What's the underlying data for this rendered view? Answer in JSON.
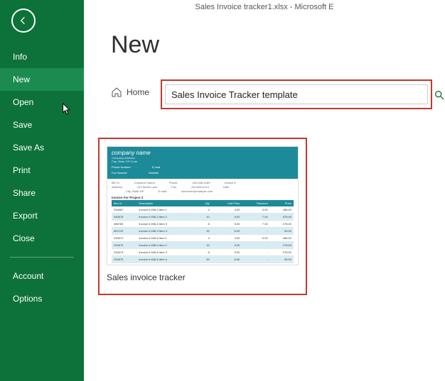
{
  "titlebar": "Sales Invoice tracker1.xlsx - Microsoft E",
  "page_title": "New",
  "sidebar": {
    "items": [
      {
        "label": "Info"
      },
      {
        "label": "New"
      },
      {
        "label": "Open"
      },
      {
        "label": "Save"
      },
      {
        "label": "Save As"
      },
      {
        "label": "Print"
      },
      {
        "label": "Share"
      },
      {
        "label": "Export"
      },
      {
        "label": "Close"
      }
    ],
    "footer": [
      {
        "label": "Account"
      },
      {
        "label": "Options"
      }
    ]
  },
  "breadcrumb": {
    "home": "Home"
  },
  "search": {
    "value": "Sales Invoice Tracker template"
  },
  "template": {
    "label": "Sales invoice tracker",
    "thumb": {
      "company": "company name",
      "sub1": "Company Address",
      "sub2": "City, State ZIP Code",
      "contact_labels": [
        "Phone Number",
        "Fax Number",
        "E-mail",
        "Website"
      ],
      "bill": {
        "to_label": "Bill To:",
        "to": "Customer Name",
        "addr_label": "Address:",
        "addr": "123 Street Lane",
        "addr2": "City, State ZIP",
        "phone_label": "Phone:",
        "phone": "432-555-0189",
        "fax_label": "Fax:",
        "fax": "432-555-0124",
        "email_label": "E-mail:",
        "email": "someone@example.com",
        "inv_label": "Invoice #",
        "date_label": "Date"
      },
      "project": "Invoice For Project 2",
      "headers": [
        "Item #",
        "Description",
        "Qty",
        "Unit Price",
        "Discount",
        "Price"
      ],
      "rows": [
        [
          "234567",
          "Invoice # 456-3 Item 1",
          "4",
          "4.00",
          "0.00",
          "456.00"
        ],
        [
          "345678",
          "Invoice # 456-3 Item 2",
          "10",
          "5.00",
          "7.00",
          "678.00"
        ],
        [
          "456789",
          "Invoice # 456-3 Item 3",
          "8",
          "5.00",
          "7.00",
          "278.00"
        ],
        [
          "567123",
          "Invoice # 456-3 Item 4",
          "20",
          "6.00",
          "-",
          "90.00"
        ],
        [
          "234572",
          "Invoice # 456-6 Item 1",
          "4",
          "4.00",
          "0.00",
          "456.00"
        ],
        [
          "234573",
          "Invoice # 456-6 Item 2",
          "10",
          "5.00",
          "-",
          "278.00"
        ],
        [
          "234574",
          "Invoice # 456-6 Item 3",
          "8",
          "5.00",
          "-",
          "278.00"
        ],
        [
          "234575",
          "Invoice # 456-6 Item 4",
          "20",
          "6.00",
          "-",
          "90.00"
        ]
      ]
    }
  }
}
